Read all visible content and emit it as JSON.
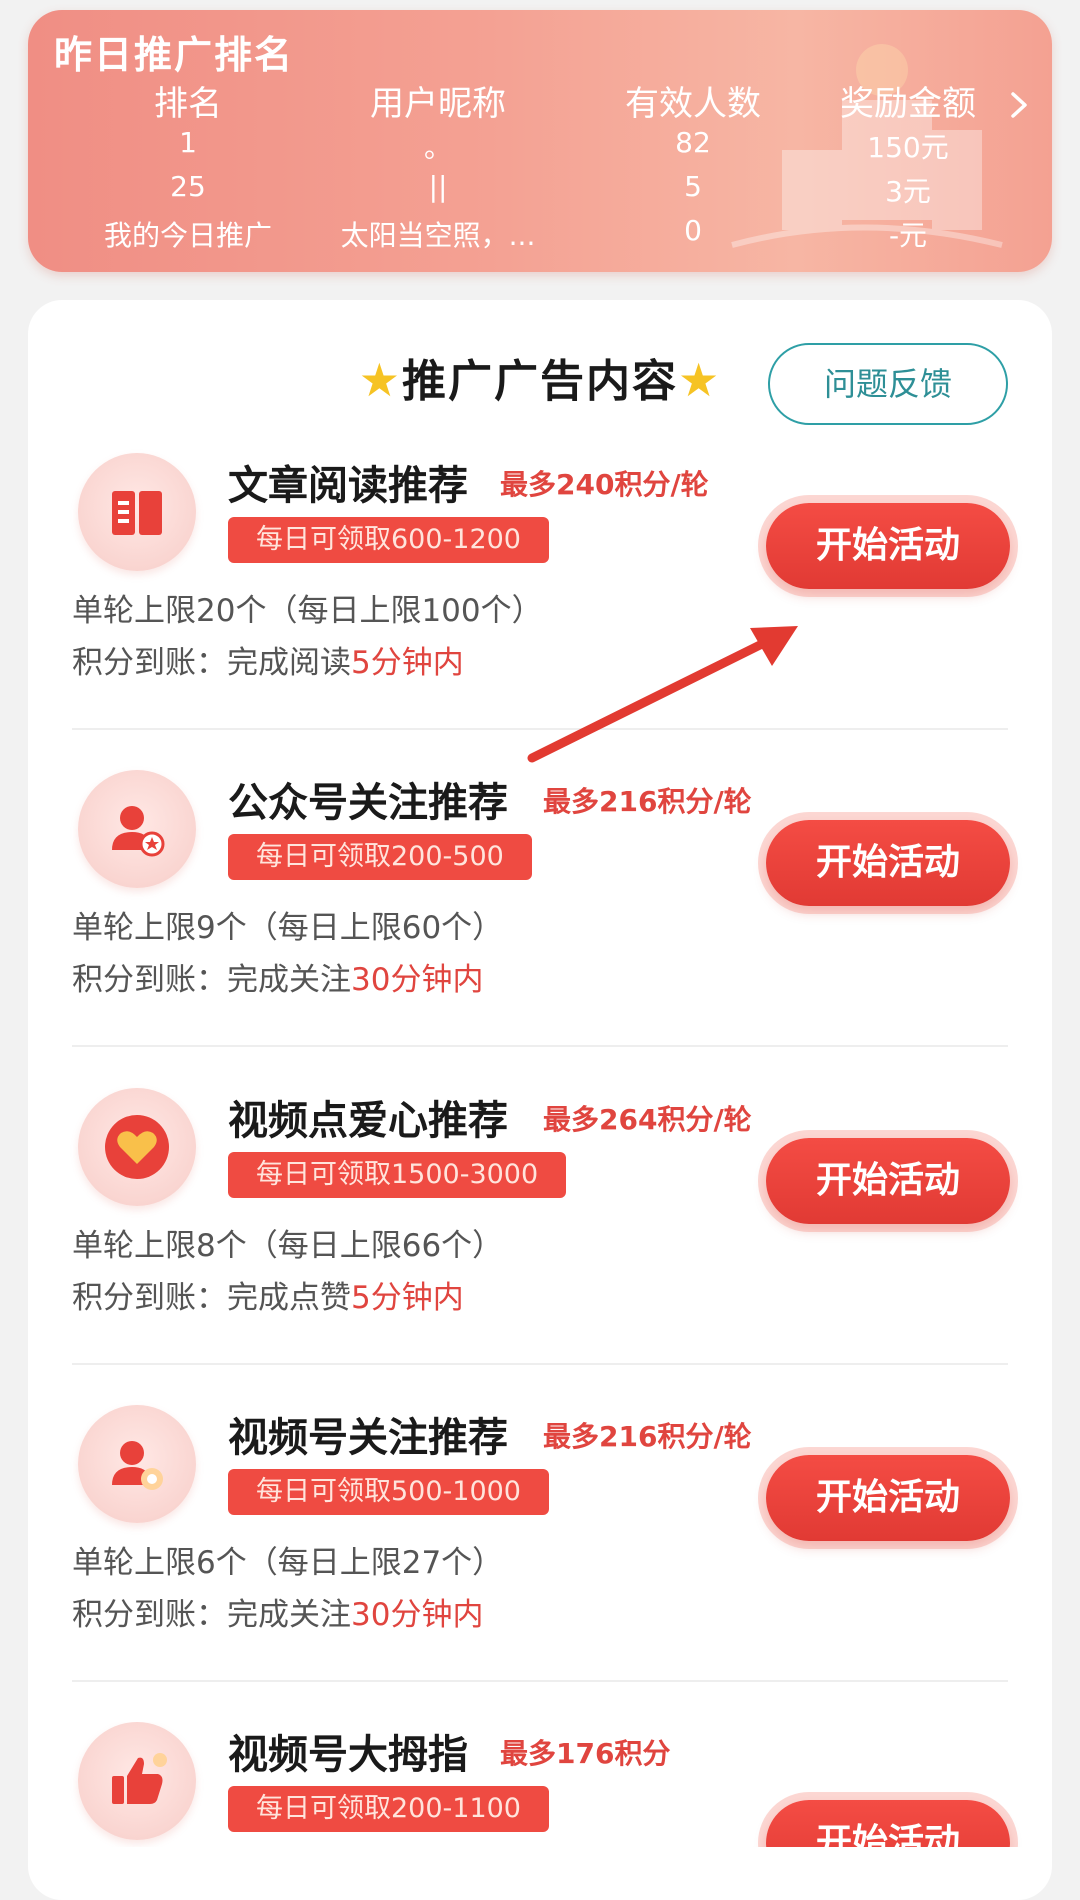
{
  "ranking": {
    "title": "昨日推广排名",
    "headers": [
      "排名",
      "用户昵称",
      "有效人数",
      "奖励金额"
    ],
    "rows": [
      {
        "rank": "1",
        "nickname": "。",
        "count": "82",
        "reward": "150元"
      },
      {
        "rank": "25",
        "nickname": "||",
        "count": "5",
        "reward": "3元"
      }
    ],
    "mine": {
      "label": "我的今日推广",
      "nickname": "太阳当空照，...",
      "count": "0",
      "reward": "-元"
    }
  },
  "section": {
    "title": "推广广告内容",
    "feedback_label": "问题反馈"
  },
  "tasks": [
    {
      "icon": "book-icon",
      "name": "文章阅读推荐",
      "max": "最多240积分/轮",
      "daily": "每日可领取600-1200",
      "limit": "单轮上限20个（每日上限100个）",
      "points_prefix": "积分到账：完成阅读",
      "points_time": "5分钟内",
      "button": "开始活动"
    },
    {
      "icon": "user-follow-icon",
      "name": "公众号关注推荐",
      "max": "最多216积分/轮",
      "daily": "每日可领取200-500",
      "limit": "单轮上限9个（每日上限60个）",
      "points_prefix": "积分到账：完成关注",
      "points_time": "30分钟内",
      "button": "开始活动"
    },
    {
      "icon": "heart-icon",
      "name": "视频点爱心推荐",
      "max": "最多264积分/轮",
      "daily": "每日可领取1500-3000",
      "limit": "单轮上限8个（每日上限66个）",
      "points_prefix": "积分到账：完成点赞",
      "points_time": "5分钟内",
      "button": "开始活动"
    },
    {
      "icon": "user-video-icon",
      "name": "视频号关注推荐",
      "max": "最多216积分/轮",
      "daily": "每日可领取500-1000",
      "limit": "单轮上限6个（每日上限27个）",
      "points_prefix": "积分到账：完成关注",
      "points_time": "30分钟内",
      "button": "开始活动"
    },
    {
      "icon": "thumbs-up-icon",
      "name": "视频号大拇指",
      "max": "最多176积分",
      "daily": "每日可领取200-1100",
      "button": "开始活动"
    }
  ],
  "colors": {
    "accent": "#e0453f",
    "button": "#f44c44",
    "teal": "#2e9fa6",
    "banner": "#f4a193"
  }
}
